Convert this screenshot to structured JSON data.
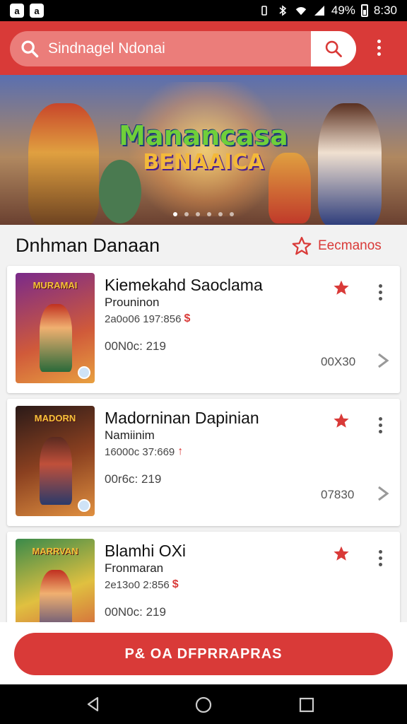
{
  "status_bar": {
    "app_icon_1": "a",
    "app_icon_2": "a",
    "battery": "49%",
    "time": "8:30"
  },
  "header": {
    "search_text": "Sindnagel Ndonai",
    "search_icon": "search-icon",
    "menu_icon": "more-vert-icon"
  },
  "banner": {
    "logo_line1": "Manancasa",
    "logo_line2": "BENAAICA",
    "slides": 6,
    "active_slide": 1
  },
  "section": {
    "title": "Dnhman Danaan",
    "favorites_label": "Eecmanos"
  },
  "cards": [
    {
      "thumb_title": "MURAMAI",
      "title": "Kiemekahd Saoclama",
      "subtitle": "Prouninon",
      "meta": "2a0o06 197:856",
      "meta_badge": "$",
      "count": "00N0c: 219",
      "code": "00X30",
      "colors": [
        "#8a2b7a",
        "#e0662c"
      ]
    },
    {
      "thumb_title": "MADORN",
      "title": "Madorninan Dapinian",
      "subtitle": "Namiinim",
      "meta": "16000c 37:669",
      "meta_badge": "↑",
      "count": "00r6c: 219",
      "code": "07830",
      "colors": [
        "#3a2420",
        "#c46a2a"
      ]
    },
    {
      "thumb_title": "MARRVAN",
      "title": "Blamhi OXi",
      "subtitle": "Fronmaran",
      "meta": "2e13o0 2:856",
      "meta_badge": "$",
      "count": "00N0c: 219",
      "code": "",
      "colors": [
        "#2f7a4a",
        "#d94a3a"
      ]
    }
  ],
  "cta": {
    "label": "P& OA DFPRRAPRAS"
  },
  "nav": {
    "back": "back-icon",
    "home": "home-icon",
    "recents": "recents-icon"
  },
  "colors": {
    "brand_red": "#d93a38",
    "search_bg": "#eb7d7a"
  }
}
